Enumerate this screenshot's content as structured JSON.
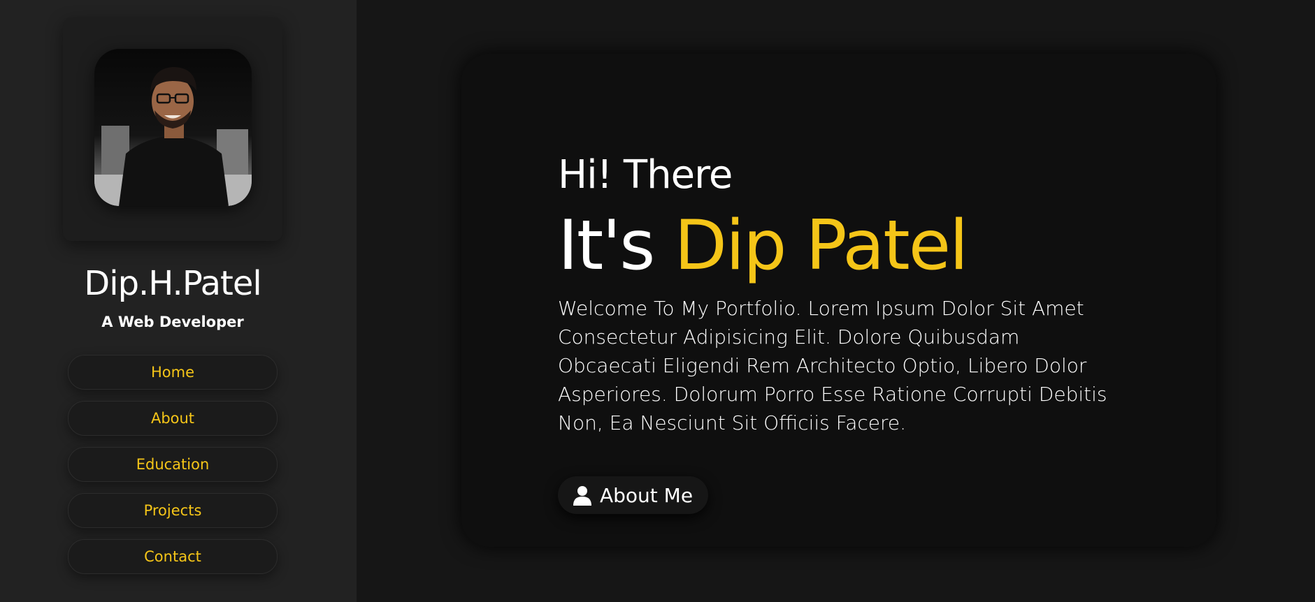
{
  "sidebar": {
    "name": "Dip.H.Patel",
    "role": "A Web Developer",
    "nav": [
      {
        "label": "Home"
      },
      {
        "label": "About"
      },
      {
        "label": "Education"
      },
      {
        "label": "Projects"
      },
      {
        "label": "Contact"
      }
    ]
  },
  "hero": {
    "greeting": "Hi! There",
    "headline_prefix": "It's ",
    "headline_name": "Dip Patel",
    "intro": "Welcome To My Portfolio. Lorem Ipsum Dolor Sit Amet Consectetur Adipisicing Elit. Dolore Quibusdam Obcaecati Eligendi Rem Architecto Optio, Libero Dolor Asperiores. Dolorum Porro Esse Ratione Corrupti Debitis Non, Ea Nesciunt Sit Officiis Facere.",
    "button_label": "About Me",
    "button_icon": "user-icon"
  },
  "colors": {
    "accent": "#f5c518",
    "sidebar_bg": "#222222",
    "page_bg": "#161616",
    "card_bg": "#0f0f0f"
  }
}
